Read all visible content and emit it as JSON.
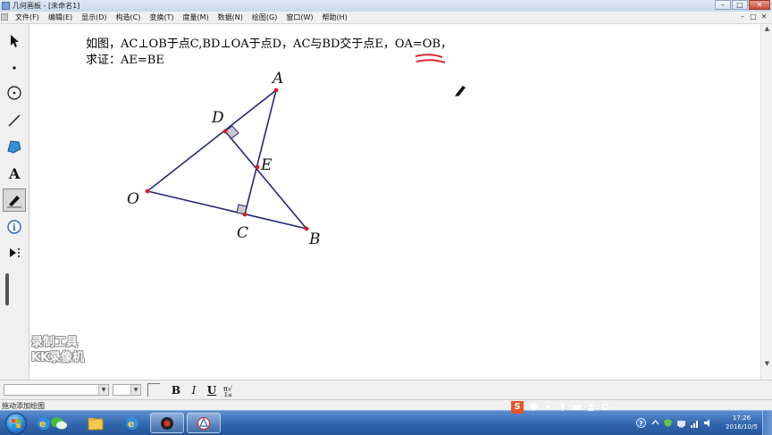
{
  "window": {
    "title": "几何画板 - [未命名1]",
    "controls": [
      "–",
      "□",
      "✕"
    ]
  },
  "menubar": {
    "items": [
      "文件(F)",
      "编辑(E)",
      "显示(D)",
      "构造(C)",
      "变换(T)",
      "度量(M)",
      "数据(N)",
      "绘图(G)",
      "窗口(W)",
      "帮助(H)"
    ],
    "mdi_controls": [
      "–",
      "□",
      "✕"
    ]
  },
  "toolbox": {
    "tools": [
      "arrow-select-tool",
      "point-tool",
      "compass-tool",
      "straightedge-tool",
      "polygon-tool",
      "text-tool",
      "marker-tool",
      "information-tool",
      "custom-tool"
    ],
    "active": "marker-tool"
  },
  "problem": {
    "line1": "如图，AC⊥OB于点C,BD⊥OA于点D，AC与BD交于点E，OA=OB，",
    "line2": "求证：AE=BE",
    "highlight": "OA=OB",
    "highlight_color": "#e0242f"
  },
  "figure": {
    "line_color": "#27277a",
    "point_color": "#d41f1f",
    "labels": {
      "A": "A",
      "B": "B",
      "C": "C",
      "D": "D",
      "E": "E",
      "O": "O"
    }
  },
  "watermark": {
    "line1": "录制工具",
    "line2": "KK录像机"
  },
  "textbar": {
    "bold": "B",
    "italic": "I",
    "underline": "U"
  },
  "status": {
    "message": "拖动添加绘图"
  },
  "taskbar": {
    "apps": [
      "ie-icon",
      "wechat-icon",
      "folder-icon",
      "ie-icon",
      "record-icon",
      "geometry-sketchpad-icon"
    ],
    "time": "17:26",
    "date": "2016/10/5",
    "ime": "S",
    "accent": "#2f63ab"
  }
}
